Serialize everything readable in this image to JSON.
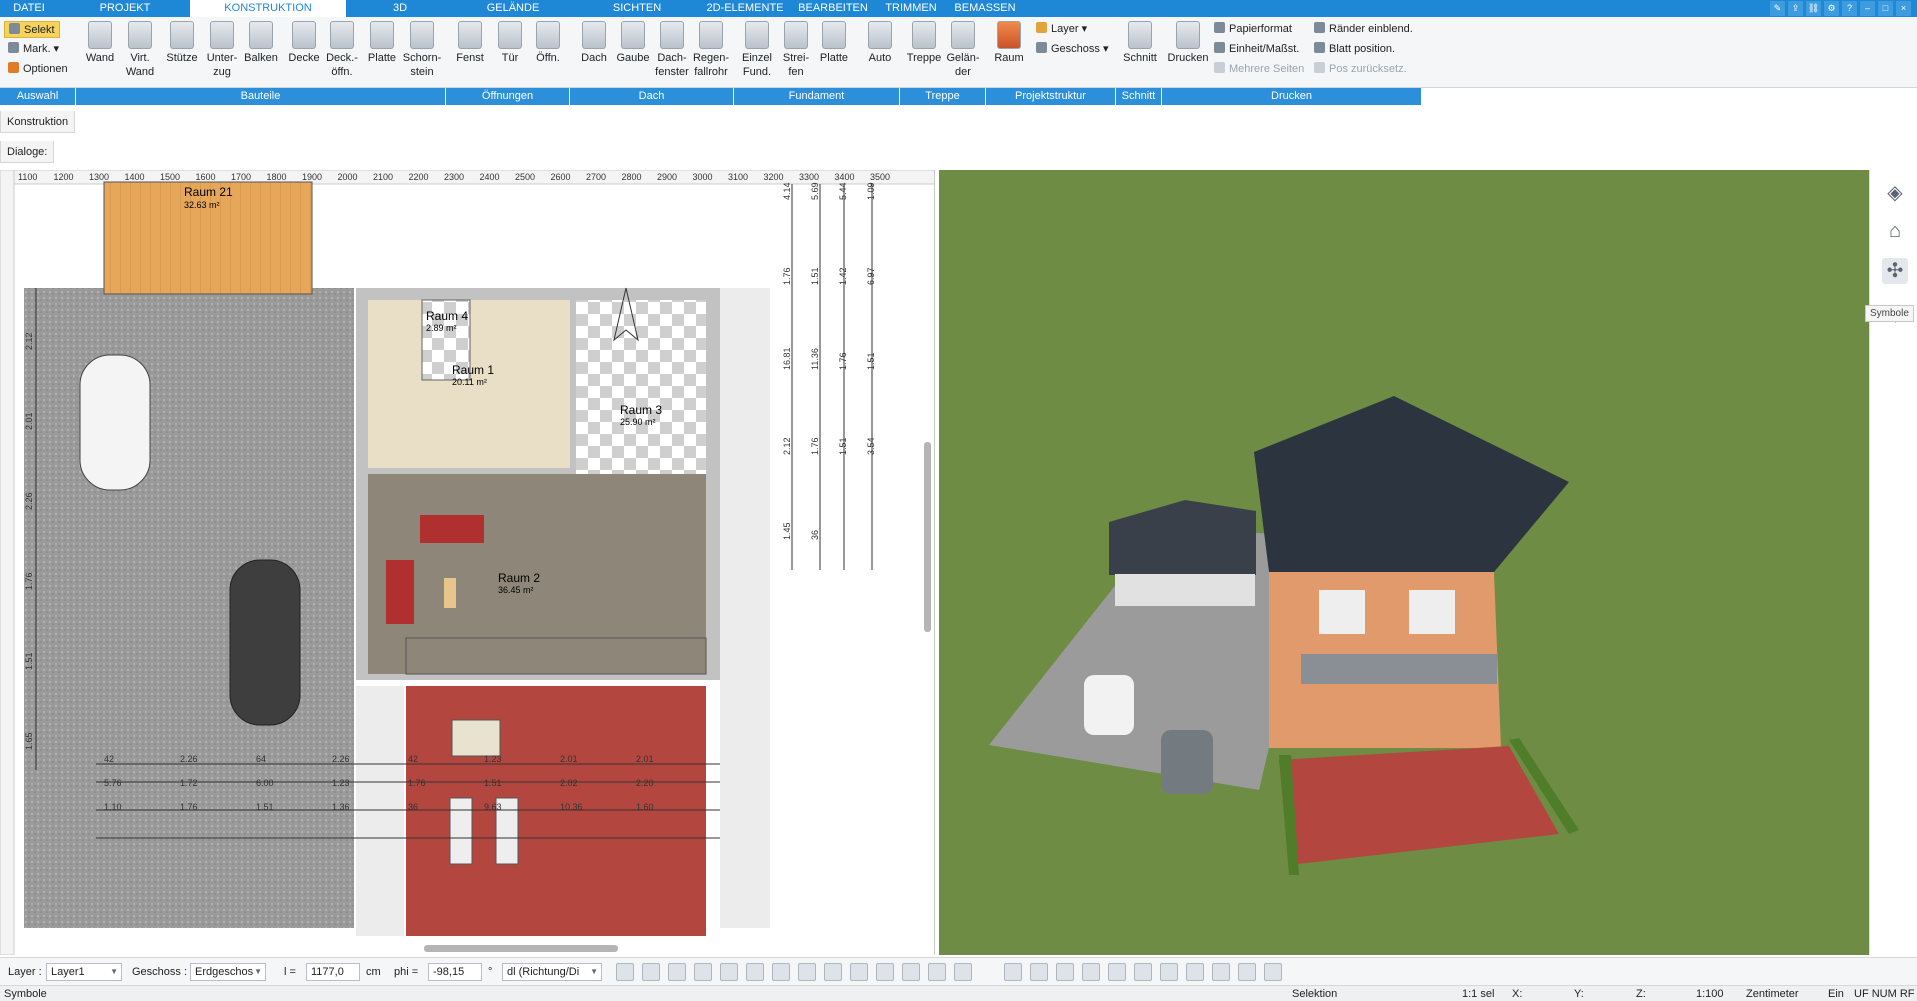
{
  "menu": {
    "tabs": [
      "DATEI",
      "PROJEKT",
      "KONSTRUKTION",
      "3D",
      "GELÄNDE",
      "SICHTEN",
      "2D-ELEMENTE",
      "BEARBEITEN",
      "TRIMMEN",
      "BEMASSEN"
    ],
    "active_tab": "KONSTRUKTION"
  },
  "ribbon": {
    "auswahl": {
      "selekt": "Selekt",
      "mark": "Mark.",
      "optionen": "Optionen"
    },
    "buttons": [
      "Wand",
      "Virt. Wand",
      "Stütze",
      "Unter-zug",
      "Balken",
      "Decke",
      "Deck.-öffn.",
      "Platte",
      "Schorn-stein",
      "Fenst",
      "Tür",
      "Öffn.",
      "Dach",
      "Gaube",
      "Dach-fenster",
      "Regen-fallrohr",
      "Einzel Fund.",
      "Strei-fen",
      "Platte",
      "Auto",
      "Treppe",
      "Gelän-der",
      "Raum",
      "Schnitt",
      "Drucken"
    ],
    "projektstruktur": {
      "layer": "Layer",
      "geschoss": "Geschoss"
    },
    "drucken": {
      "papierformat": "Papierformat",
      "einheit": "Einheit/Maßst.",
      "mehrere": "Mehrere Seiten",
      "raender": "Ränder einblend.",
      "blatt": "Blatt position.",
      "pos": "Pos zurücksetz."
    },
    "groups": [
      "Auswahl",
      "Bauteile",
      "Öffnungen",
      "Dach",
      "Fundament",
      "Treppe",
      "Projektstruktur",
      "Schnitt",
      "Drucken"
    ]
  },
  "panels": {
    "konstruktion": "Konstruktion",
    "dialoge": "Dialoge:"
  },
  "plan": {
    "rooms": [
      {
        "name": "Raum 21",
        "area": "32.63 m²"
      },
      {
        "name": "Raum 4",
        "area": "2.89 m²"
      },
      {
        "name": "Raum 1",
        "area": "20.11 m²"
      },
      {
        "name": "Raum 3",
        "area": "25.90 m²"
      },
      {
        "name": "Raum 2",
        "area": "36.45 m²"
      }
    ],
    "ruler_top": [
      "1100",
      "1200",
      "1300",
      "1400",
      "1500",
      "1600",
      "1700",
      "1800",
      "1900",
      "2000",
      "2100",
      "2200",
      "2300",
      "2400",
      "2500",
      "2600",
      "2700",
      "2800",
      "2900",
      "3000",
      "3100",
      "3200",
      "3300",
      "3400",
      "3500"
    ],
    "dims_bottom": [
      "42",
      "2.26",
      "64",
      "2.26",
      "42",
      "1.23",
      "2.01",
      "2.01",
      "5.76",
      "1.72",
      "6.00",
      "1.23",
      "1.76",
      "1.51",
      "2.02",
      "2.20",
      "1.10",
      "1.76",
      "1.51",
      "1.36",
      "36",
      "9.63",
      "10.36",
      "1.60"
    ],
    "dims_right": [
      "4.14",
      "5.69",
      "5.44",
      "1.09",
      "1.76",
      "1.51",
      "1.42",
      "6.97",
      "16.81",
      "11.36",
      "1.76",
      "1.51",
      "2.12",
      "1.76",
      "1.51",
      "3.54",
      "1.45",
      "36"
    ],
    "dims_left": [
      "2.12",
      "2.01",
      "2.26",
      "1.76",
      "1.51",
      "1.65"
    ]
  },
  "right_tools": {
    "tooltip": "Symbole"
  },
  "bottom": {
    "layer_label": "Layer :",
    "layer_value": "Layer1",
    "geschoss_label": "Geschoss :",
    "geschoss_value": "Erdgeschos",
    "l_label": "l =",
    "l_value": "1177,0",
    "l_unit": "cm",
    "phi_label": "phi =",
    "phi_value": "-98,15",
    "phi_unit": "°",
    "direction_value": "dl (Richtung/Di"
  },
  "status": {
    "left": "Symbole",
    "selektion": "Selektion",
    "sel_count": "1:1 sel",
    "x": "X:",
    "y": "Y:",
    "z": "Z:",
    "scale": "1:100",
    "unit": "Zentimeter",
    "ein": "Ein",
    "flags": "UF NUM RF"
  },
  "colors": {
    "accent": "#1e88d6",
    "grass": "#6e8c44",
    "roof": "#2c3440",
    "facade": "#e09a6b",
    "terrace": "#b3473f"
  }
}
